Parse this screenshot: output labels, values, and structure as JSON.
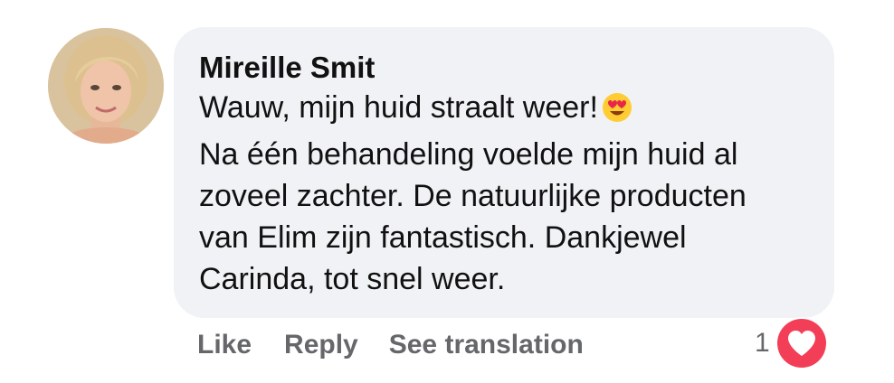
{
  "comment": {
    "author": "Mireille Smit",
    "lines": [
      "Wauw, mijn huid straalt weer!",
      "Na één behandeling voelde mijn huid al",
      "zoveel zachter. De natuurlijke producten",
      "van Elim zijn fantastisch. Dankjewel",
      "Carinda, tot snel weer."
    ],
    "emoji": "heart-eyes-emoji"
  },
  "actions": {
    "like": "Like",
    "reply": "Reply",
    "translate": "See translation"
  },
  "reactions": {
    "count": "1",
    "icon": "heart-icon",
    "color": "#f33e58"
  },
  "colors": {
    "bubble": "#f0f2f5",
    "text": "#111111",
    "muted": "#65676b"
  }
}
